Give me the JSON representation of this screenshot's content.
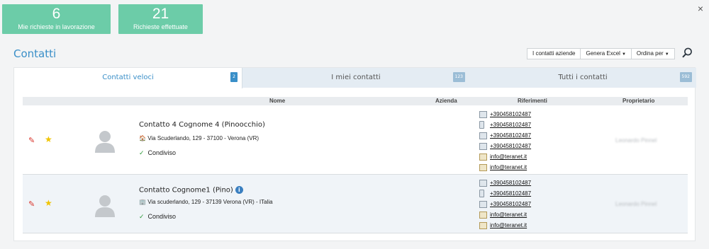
{
  "close_label": "×",
  "stats": [
    {
      "value": "6",
      "label": "Mie richieste in lavorazione"
    },
    {
      "value": "21",
      "label": "Richieste effettuate"
    }
  ],
  "page_title": "Contatti",
  "toolbar": {
    "aziende_label": "I contatti aziende",
    "excel_label": "Genera Excel",
    "order_label": "Ordina per"
  },
  "tabs": [
    {
      "label": "Contatti veloci",
      "count": "2"
    },
    {
      "label": "I miei contatti",
      "count": "123"
    },
    {
      "label": "Tutti i contatti",
      "count": "592"
    }
  ],
  "columns": {
    "nome": "Nome",
    "azienda": "Azienda",
    "riferimenti": "Riferimenti",
    "proprietario": "Proprietario"
  },
  "contacts": [
    {
      "name": "Contatto 4 Cognome 4 (Pinoocchio)",
      "address": "Via Scuderlando, 129 - 37100 - Verona (VR)",
      "shared": "Condiviso",
      "owner": "Leonardo Pinnel",
      "refs": [
        "+390458102487",
        "+390458102487",
        "+390458102487",
        "+390458102487",
        "info@teranet.it",
        "info@teranet.it"
      ]
    },
    {
      "name": "Contatto Cognome1 (Pino)",
      "address": "Via scuderlando, 129 - 37139 Verona (VR) - ITalia",
      "shared": "Condiviso",
      "owner": "Leonardo Pinnel",
      "refs": [
        "+390458102487",
        "+390458102487",
        "+390458102487",
        "info@teranet.it",
        "info@teranet.it"
      ]
    }
  ],
  "colors": {
    "accent": "#3a8fc8",
    "tile": "#6ccca8",
    "edit": "#d9342b",
    "star": "#f0c400"
  }
}
